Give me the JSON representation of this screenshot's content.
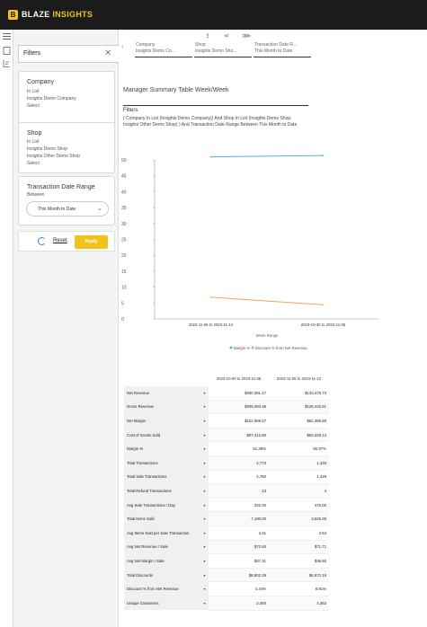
{
  "app": {
    "logo_glyph": "B",
    "brand_main": "BLAZE ",
    "brand_accent": "INSIGHTS"
  },
  "rail": {
    "icons": [
      "hamburger-menu-icon",
      "page-icon",
      "filter-panel-icon"
    ]
  },
  "filters_panel": {
    "title": "Filters",
    "close_glyph": "✕",
    "company": {
      "title": "Company",
      "operator": "In List",
      "value": "Insights Demo Company",
      "action": "Select"
    },
    "shop": {
      "title": "Shop",
      "operator": "In List",
      "values": [
        "Insights Demo Shop",
        "Insights Other Demo Shop"
      ],
      "action": "Select"
    },
    "date_range": {
      "title": "Transaction Date Range",
      "operator": "Between",
      "selected": "This Month to Date",
      "chevron": "⌄"
    },
    "reset_label": "Reset",
    "apply_label": "Apply"
  },
  "toolbar": {
    "icons": [
      "download-icon",
      "share-icon",
      "pin-icon"
    ],
    "glyphs": [
      "⇪",
      "⋖",
      "⋙"
    ]
  },
  "breadcrumbs": [
    {
      "line1": "Company",
      "line2": "Insights Demo Co..."
    },
    {
      "line1": "Shop",
      "line2": "Insights Demo Sho..."
    },
    {
      "line1": "Transaction Date R...",
      "line2": "This Month to Date"
    }
  ],
  "report": {
    "title": "Manager Summary Table Week/Week",
    "filters_label": "Filters",
    "filters_description": "( Company In List (Insights Demo Company)) And Shop In List (Insights Demo Shop, Insights Other Demo Shop) ) And Transaction Date Range Between This Month to Date"
  },
  "chart_data": {
    "type": "line",
    "categories": [
      "2023-11-06 to 2023-11-12",
      "2023-10-30 to 2023-11-05"
    ],
    "series": [
      {
        "name": "Margin %",
        "values": [
          50.97,
          51.39
        ],
        "color": "#4fb4d8"
      },
      {
        "name": "Discount % from Net Revenue",
        "values": [
          6.81,
          4.44
        ],
        "color": "#f0a35b"
      }
    ],
    "xlabel": "Week Range",
    "ylabel": "",
    "ylim": [
      0,
      50
    ],
    "yticks": [
      0,
      5,
      10,
      15,
      20,
      25,
      30,
      35,
      40,
      45,
      50
    ],
    "grid": false,
    "legend_position": "bottom"
  },
  "table": {
    "columns": [
      "2023-10-30 to 2023-11-05",
      "2023-11-06 to 2023-11-12"
    ],
    "rows": [
      {
        "label": "Net Revenue",
        "values": [
          "$200,391.17",
          "$133,475.73"
        ]
      },
      {
        "label": "Gross Revenue",
        "values": [
          "$209,293.46",
          "$139,433.91"
        ]
      },
      {
        "label": "Net Margin",
        "values": [
          "$102,969.57",
          "$62,395.59"
        ]
      },
      {
        "label": "Cost of Goods Sold",
        "values": [
          "$97,412.60",
          "$63,349.14"
        ]
      },
      {
        "label": "Margin %",
        "values": [
          "51.39%",
          "50.97%"
        ]
      },
      {
        "label": "Total Transactions",
        "values": [
          "2,773",
          "1,433"
        ]
      },
      {
        "label": "Total Sale Transactions",
        "values": [
          "2,760",
          "1,429"
        ]
      },
      {
        "label": "Total Refund Transactions",
        "values": [
          "13",
          "4"
        ]
      },
      {
        "label": "Avg Sale Transactions / Day",
        "values": [
          "332.00",
          "476.00"
        ]
      },
      {
        "label": "Total Items Sold",
        "values": [
          "7,190.00",
          "3,625.00"
        ]
      },
      {
        "label": "Avg Items Sold per Sale Transaction",
        "values": [
          "2.61",
          "2.54"
        ]
      },
      {
        "label": "Avg Net Revenue / Sale",
        "values": [
          "$72.60",
          "$71.71"
        ]
      },
      {
        "label": "Avg Net Margin / Sale",
        "values": [
          "$37.31",
          "$36.55"
        ]
      },
      {
        "label": "Total Discounts",
        "values": [
          "$8,902.29",
          "$6,972.19"
        ]
      },
      {
        "label": "Discount % from Net Revenue",
        "values": [
          "4.44%",
          "6.81%"
        ]
      },
      {
        "label": "Unique Customers",
        "values": [
          "2,493",
          "1,353"
        ]
      }
    ]
  }
}
